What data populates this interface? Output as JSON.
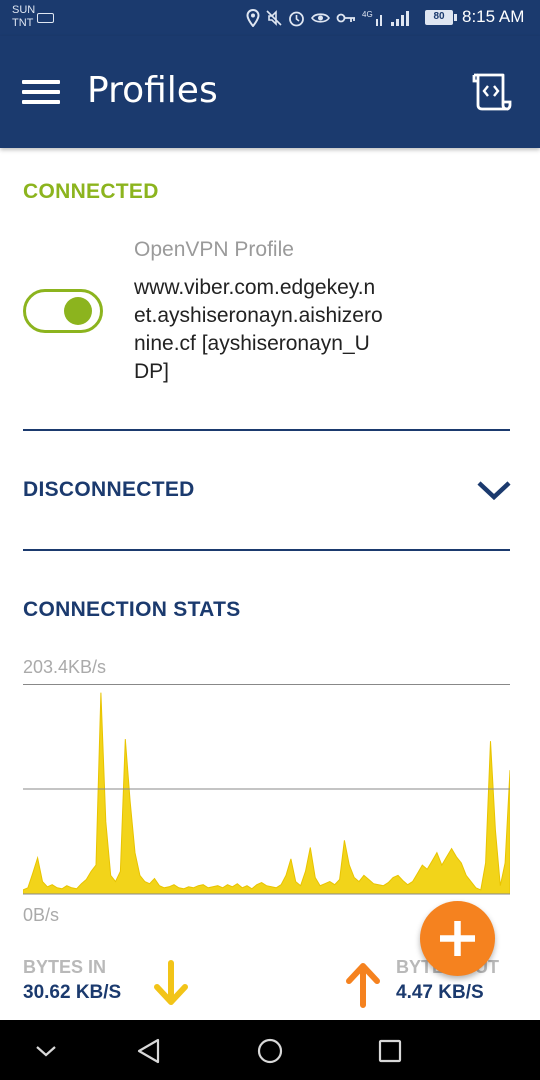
{
  "status_bar": {
    "carrier_line1": "SUN",
    "carrier_line2": "TNT",
    "network_type": "4G",
    "battery": "80",
    "time": "8:15 AM",
    "icons": [
      "location-icon",
      "mute-icon",
      "alarm-icon",
      "eye-icon",
      "vpn-key-icon",
      "data-4g-icon",
      "signal-icon",
      "battery-icon"
    ]
  },
  "app_bar": {
    "title": "Profiles",
    "menu_icon": "hamburger-menu-icon",
    "action_icon": "import-profile-icon"
  },
  "connected": {
    "label": "CONNECTED",
    "toggle_on": true,
    "profile_type": "OpenVPN Profile",
    "profile_name": "www.viber.com.edgekey.net.ayshiseronayn.aishizeronine.cf [ayshiseronayn_UDP]"
  },
  "disconnected": {
    "label": "DISCONNECTED",
    "expand_icon": "chevron-down-icon"
  },
  "stats": {
    "label": "CONNECTION STATS",
    "max_label": "203.4KB/s",
    "min_label": "0B/s",
    "bytes_in_label": "BYTES IN",
    "bytes_in_value": "30.62 KB/S",
    "bytes_out_label": "BYTES OUT",
    "bytes_out_value": "4.47 KB/S"
  },
  "chart_data": {
    "type": "area",
    "ylim": [
      0,
      203.4
    ],
    "y_unit": "KB/s",
    "series": [
      {
        "values": [
          4,
          6,
          20,
          35,
          12,
          7,
          9,
          6,
          5,
          8,
          6,
          5,
          10,
          14,
          22,
          28,
          195,
          70,
          18,
          12,
          22,
          150,
          90,
          40,
          18,
          12,
          10,
          15,
          8,
          6,
          7,
          9,
          6,
          5,
          7,
          6,
          8,
          9,
          6,
          7,
          8,
          6,
          9,
          7,
          10,
          6,
          8,
          5,
          9,
          11,
          8,
          7,
          6,
          9,
          18,
          34,
          12,
          8,
          22,
          45,
          16,
          8,
          10,
          12,
          9,
          14,
          52,
          28,
          16,
          12,
          18,
          14,
          10,
          9,
          8,
          11,
          16,
          18,
          13,
          9,
          12,
          20,
          28,
          24,
          32,
          40,
          28,
          36,
          44,
          36,
          30,
          18,
          12,
          6,
          4,
          30,
          148,
          62,
          8,
          30,
          120
        ]
      }
    ],
    "colors": {
      "fill": "#f2d41a",
      "stroke": "#e8c400"
    }
  },
  "colors": {
    "primary": "#1b3a6e",
    "accent_green": "#8cb41e",
    "fab_orange": "#f5821f",
    "arrow_in": "#f2c418",
    "arrow_out": "#f5821f"
  },
  "fab": {
    "icon": "plus-icon"
  },
  "nav_bar": {
    "icons": [
      "collapse-icon",
      "back-icon",
      "home-icon",
      "recents-icon"
    ]
  }
}
